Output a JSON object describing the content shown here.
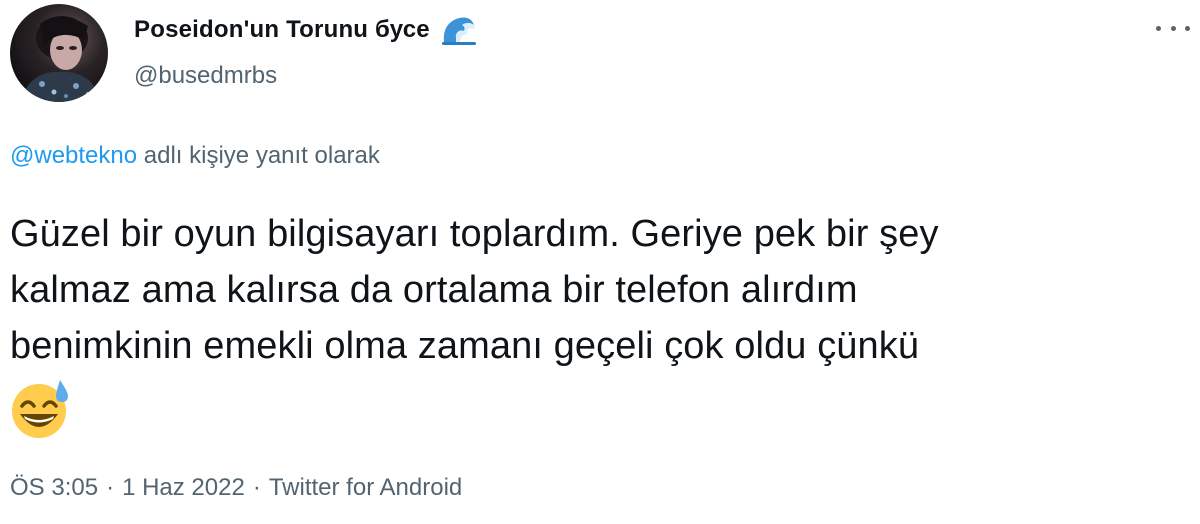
{
  "user": {
    "display_name": "Poseidon'un Torunu бусе",
    "handle": "@busedmrbs",
    "name_emoji": "wave-emoji",
    "avatar": "avatar-photo"
  },
  "menu": {
    "icon": "more-dots-icon"
  },
  "reply": {
    "mention": "@webtekno",
    "suffix": " adlı kişiye yanıt olarak"
  },
  "tweet": {
    "lines": [
      "Güzel bir oyun bilgisayarı toplardım. Geriye pek bir şey",
      "kalmaz ama kalırsa da ortalama bir telefon alırdım",
      "benimkinin emekli olma zamanı geçeli çok oldu çünkü"
    ],
    "emoji": "grinning-sweat-emoji"
  },
  "meta": {
    "time": "ÖS 3:05",
    "separator": "·",
    "date": "1 Haz 2022",
    "source": "Twitter for Android"
  },
  "colors": {
    "link": "#1d9bf0",
    "secondary": "#536471",
    "text": "#0f1419"
  }
}
